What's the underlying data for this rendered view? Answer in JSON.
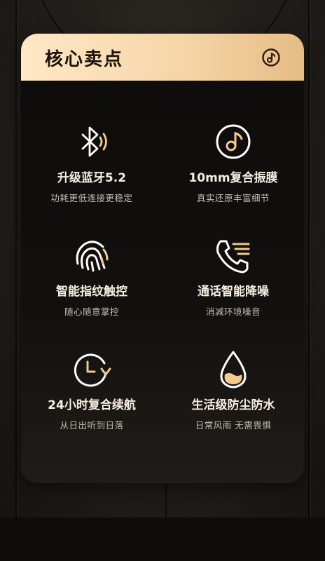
{
  "section": {
    "title": "核心卖点",
    "header_icon": "music-note-circle-icon"
  },
  "features": [
    {
      "icon": "bluetooth-icon",
      "title": "升级蓝牙5.2",
      "subtitle": "功耗更低连接更稳定"
    },
    {
      "icon": "music-note-circle-icon",
      "title": "10mm复合振膜",
      "subtitle": "真实还原丰富细节"
    },
    {
      "icon": "fingerprint-icon",
      "title": "智能指纹触控",
      "subtitle": "随心随意掌控"
    },
    {
      "icon": "phone-call-icon",
      "title": "通话智能降噪",
      "subtitle": "消减环境噪音"
    },
    {
      "icon": "clock-refresh-icon",
      "title": "24小时复合续航",
      "subtitle": "从日出听到日落"
    },
    {
      "icon": "water-drop-icon",
      "title": "生活级防尘防水",
      "subtitle": "日常风雨 无需畏惧"
    }
  ],
  "colors": {
    "accent_gold": "#f2c98f",
    "header_gradient_start": "#ffe8c6",
    "header_gradient_end": "#e6bc86",
    "icon_white": "#ffffff",
    "text_primary": "#f5ede3",
    "text_secondary": "#c9beb1"
  }
}
